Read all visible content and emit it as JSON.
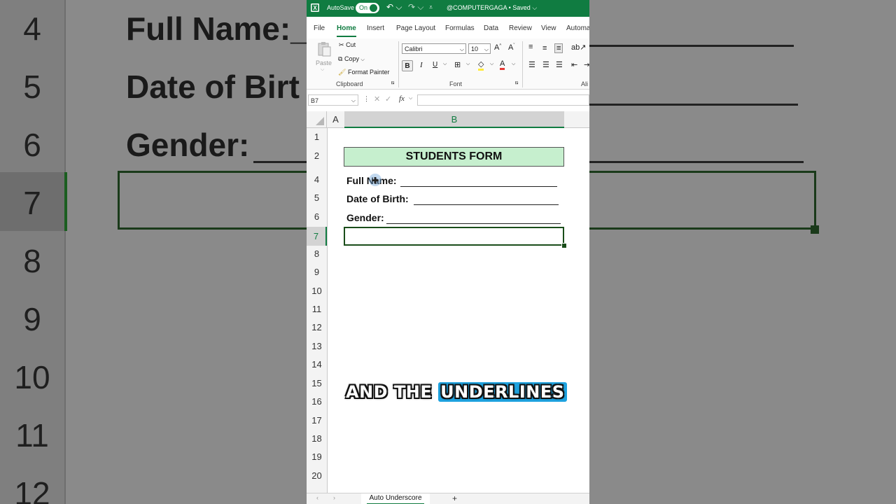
{
  "background": {
    "row_numbers": [
      "4",
      "5",
      "6",
      "7",
      "8",
      "9",
      "10",
      "11",
      "12"
    ],
    "texts": [
      "Full Name:_",
      "Date of Birt",
      "Gender:"
    ]
  },
  "titlebar": {
    "autosave_label": "AutoSave",
    "toggle_label": "On",
    "doc_title": "@COMPUTERGAGA • Saved ⌵"
  },
  "tabs": [
    "File",
    "Home",
    "Insert",
    "Page Layout",
    "Formulas",
    "Data",
    "Review",
    "View",
    "Automa"
  ],
  "ribbon": {
    "clipboard": {
      "paste_label": "Paste",
      "cut_label": "Cut",
      "copy_label": "Copy",
      "format_painter_label": "Format Painter",
      "group_label": "Clipboard"
    },
    "font": {
      "font_name": "Calibri",
      "font_size": "10",
      "bold": "B",
      "italic": "I",
      "underline": "U",
      "group_label": "Font"
    },
    "alignment": {
      "group_label": "Ali"
    }
  },
  "formula_bar": {
    "name_box": "B7",
    "fx_label": "fx"
  },
  "columns": [
    "A",
    "B"
  ],
  "rows": [
    "1",
    "2",
    "4",
    "5",
    "6",
    "7",
    "8",
    "9",
    "10",
    "11",
    "12",
    "13",
    "14",
    "15",
    "16",
    "17",
    "18",
    "19",
    "20"
  ],
  "sheet": {
    "title": "STUDENTS FORM",
    "fields": [
      "Full Name:",
      "Date of Birth:",
      "Gender:"
    ]
  },
  "caption": {
    "prefix": "AND THE ",
    "highlight": "UNDERLINES"
  },
  "sheet_tabs": {
    "active": "Auto Underscore",
    "add_label": "+"
  },
  "colors": {
    "excel_green": "#107c41",
    "title_fill": "#c6efce",
    "caption_highlight": "#1fa3e0"
  }
}
